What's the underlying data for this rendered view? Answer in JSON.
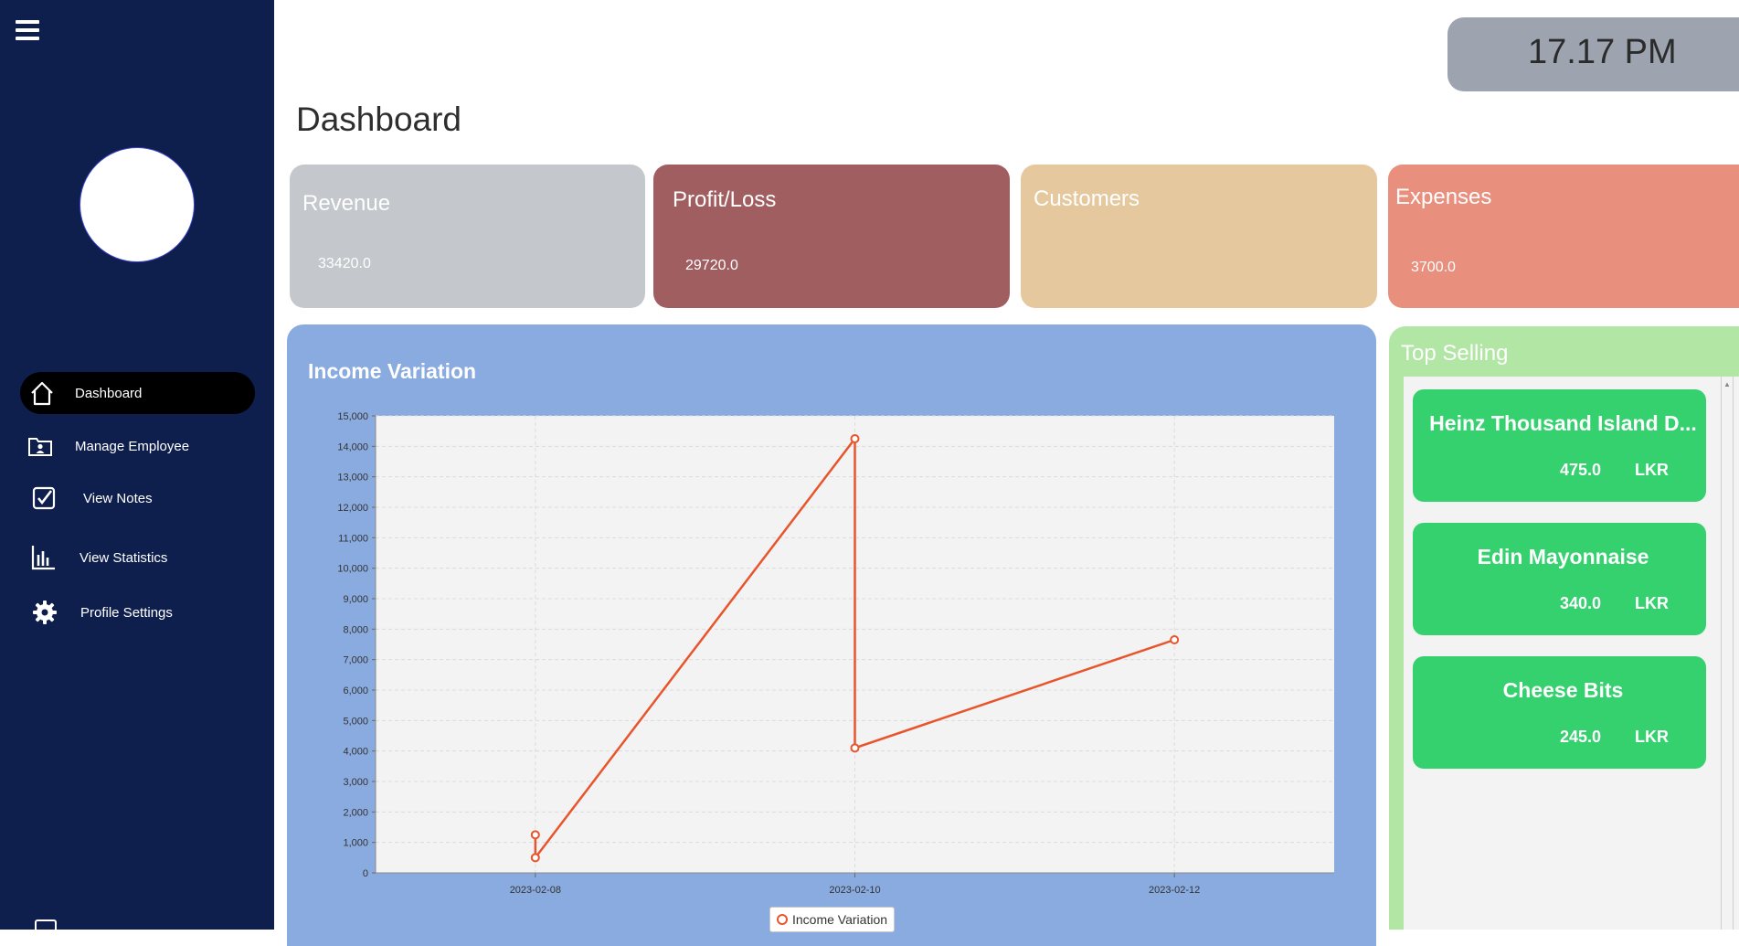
{
  "header": {
    "clock": "17.17 PM",
    "page_title": "Dashboard"
  },
  "sidebar": {
    "items": [
      {
        "label": "Dashboard",
        "icon": "home-icon",
        "active": true
      },
      {
        "label": "Manage Employee",
        "icon": "employee-folder-icon"
      },
      {
        "label": "View Notes",
        "icon": "checkbox-icon"
      },
      {
        "label": "View Statistics",
        "icon": "bar-chart-icon"
      },
      {
        "label": "Profile Settings",
        "icon": "gear-icon"
      }
    ]
  },
  "cards": [
    {
      "title": "Revenue",
      "value": "33420.0",
      "color": "#c4c7cc"
    },
    {
      "title": "Profit/Loss",
      "value": "29720.0",
      "color": "#a05e61"
    },
    {
      "title": "Customers",
      "value": "",
      "color": "#e6c89e"
    },
    {
      "title": "Expenses",
      "value": "3700.0",
      "color": "#e88f7d"
    }
  ],
  "chart_title": "Income Variation",
  "legend_label": "Income Variation",
  "chart_data": {
    "type": "line",
    "title": "Income Variation",
    "x_ticks": [
      "2023-02-08",
      "2023-02-10",
      "2023-02-12"
    ],
    "y_ticks": [
      "0",
      "1,000",
      "2,000",
      "3,000",
      "4,000",
      "5,000",
      "6,000",
      "7,000",
      "8,000",
      "9,000",
      "10,000",
      "11,000",
      "12,000",
      "13,000",
      "14,000",
      "15,000"
    ],
    "ylim": [
      0,
      15000
    ],
    "xlim": [
      "2023-02-07",
      "2023-02-13"
    ],
    "series": [
      {
        "name": "Income Variation",
        "color": "#e8552c",
        "points": [
          {
            "x": "2023-02-08",
            "y": 1250
          },
          {
            "x": "2023-02-08",
            "y": 500
          },
          {
            "x": "2023-02-10",
            "y": 14250
          },
          {
            "x": "2023-02-10",
            "y": 4100
          },
          {
            "x": "2023-02-12",
            "y": 7650
          }
        ]
      }
    ],
    "grid": true,
    "legend_position": "bottom"
  },
  "top_selling": {
    "title": "Top Selling",
    "items": [
      {
        "name": "Heinz Thousand Island D...",
        "price": "475.0",
        "currency": "LKR"
      },
      {
        "name": "Edin Mayonnaise",
        "price": "340.0",
        "currency": "LKR"
      },
      {
        "name": "Cheese Bits",
        "price": "245.0",
        "currency": "LKR"
      }
    ]
  }
}
